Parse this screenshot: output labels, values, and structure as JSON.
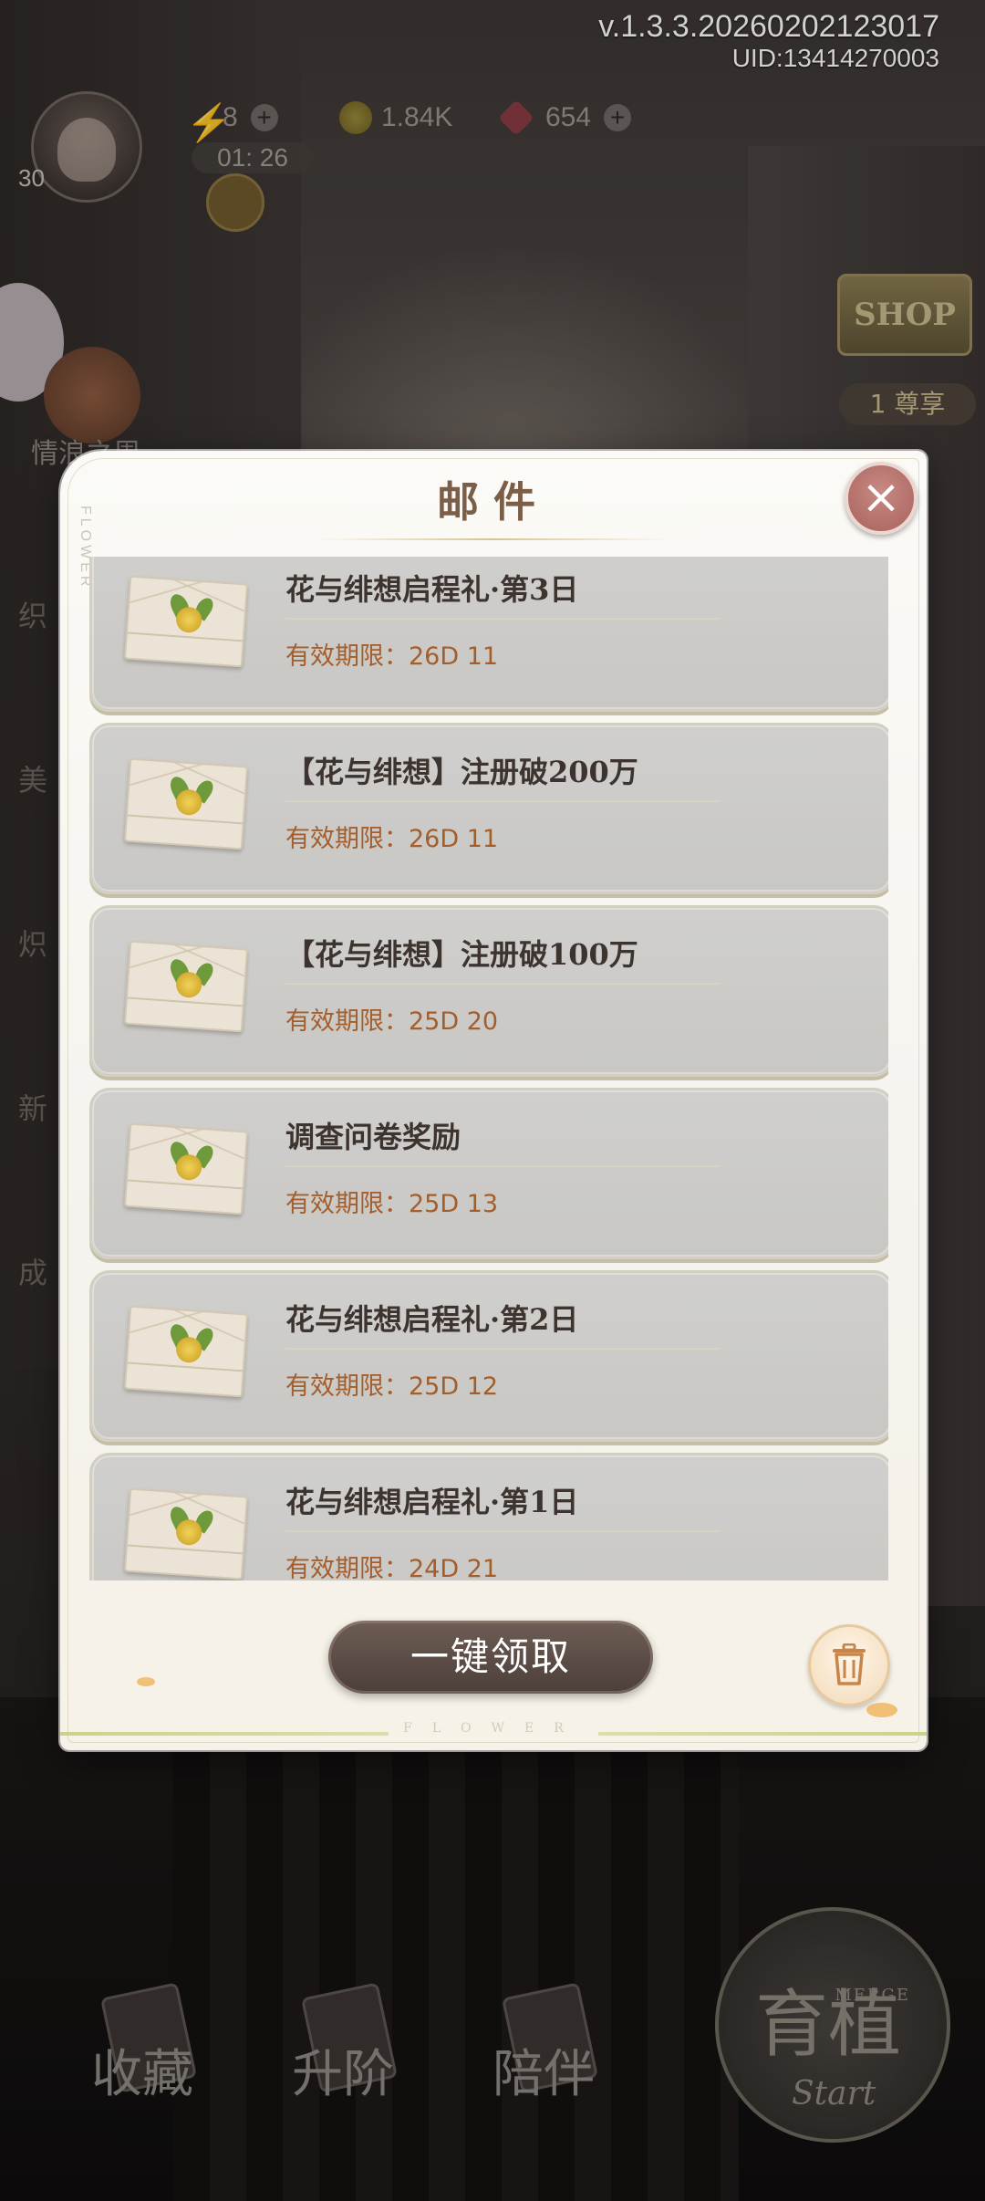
{
  "version": {
    "version": "v.1.3.3.20260202123017",
    "uid": "UID:13414270003"
  },
  "player": {
    "level": "30"
  },
  "resources": {
    "energy": "8",
    "coins": "1.84K",
    "gems": "654",
    "timer": "01: 26"
  },
  "side_menu": {
    "event_label": "情浪之周",
    "fragments": [
      "织",
      "美",
      "炽",
      "新",
      "成"
    ]
  },
  "shop": {
    "label": "SHOP",
    "vip_label": "尊享",
    "vip_level": "1"
  },
  "bottom_nav": {
    "collect": "收藏",
    "upgrade": "升阶",
    "accompany": "陪伴",
    "merge_big": "育植",
    "merge_small": "MERGE",
    "merge_start": "Start"
  },
  "mail_dialog": {
    "title": "邮件",
    "side_deco": "FLOWER",
    "footer_deco": "FLOWER",
    "claim_all_label": "一键领取",
    "mails": [
      {
        "title": "花与绯想启程礼·第3日",
        "expiry": "有效期限：26D 11"
      },
      {
        "title": "【花与绯想】注册破200万",
        "expiry": "有效期限：26D 11"
      },
      {
        "title": "【花与绯想】注册破100万",
        "expiry": "有效期限：25D 20"
      },
      {
        "title": "调查问卷奖励",
        "expiry": "有效期限：25D 13"
      },
      {
        "title": "花与绯想启程礼·第2日",
        "expiry": "有效期限：25D 12"
      },
      {
        "title": "花与绯想启程礼·第1日",
        "expiry": "有效期限：24D 21"
      }
    ]
  },
  "icons": {
    "close": "close-icon",
    "trash": "trash-icon",
    "envelope": "envelope-icon"
  }
}
